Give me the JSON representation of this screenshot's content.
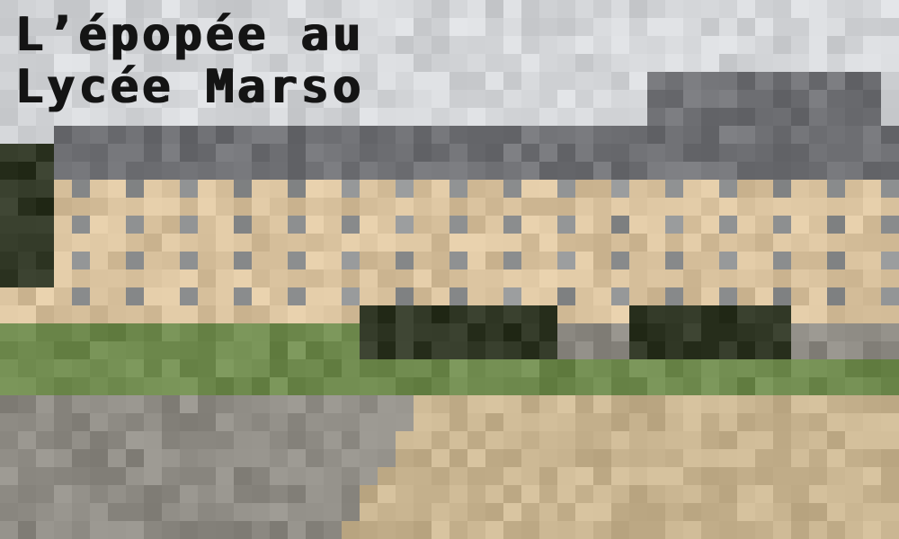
{
  "title": {
    "line1": "L’épopée au",
    "line2": "Lycée Marso"
  },
  "scene": {
    "background_image": "pixelated-school-building",
    "colors": {
      "sky": "#d3d5d8",
      "roof": "#6f7074",
      "facade": "#d9c29e",
      "window": "#8d8f90",
      "hedge": "#2f3624",
      "grass": "#6f8a4e",
      "path": "#c8b490",
      "road": "#8e8b84",
      "title_text": "#141414"
    }
  }
}
